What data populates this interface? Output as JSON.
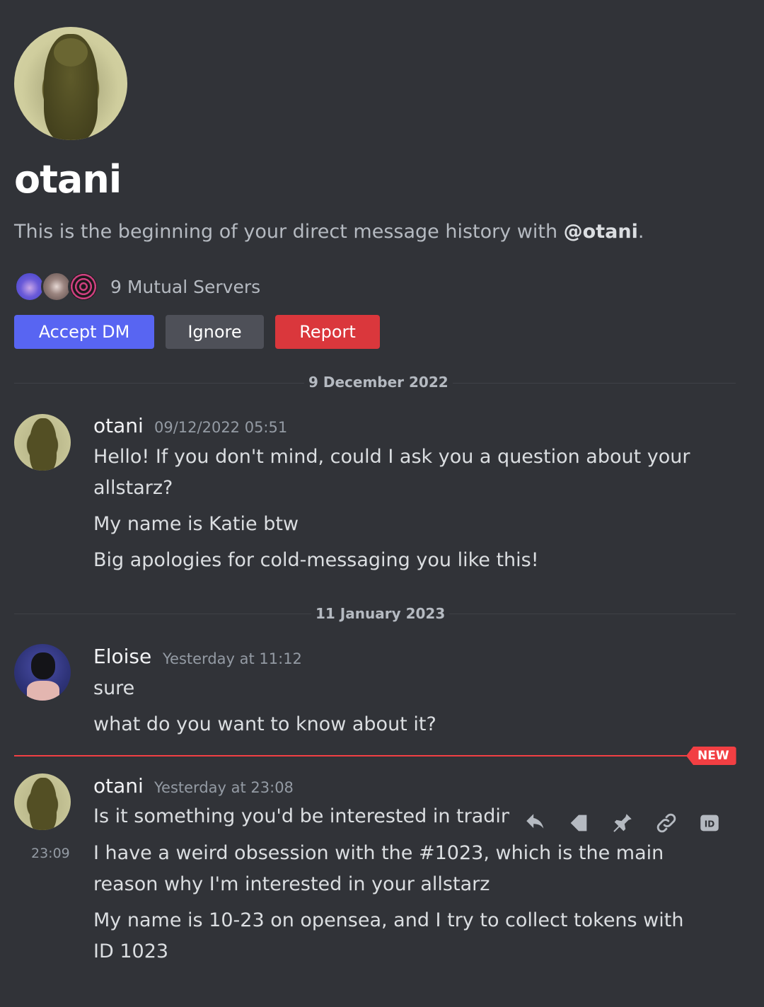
{
  "header": {
    "username": "otani",
    "intro_prefix": "This is the beginning of your direct message history with ",
    "intro_handle": "@otani",
    "intro_suffix": ".",
    "mutual_servers": "9 Mutual Servers"
  },
  "actions": {
    "accept": "Accept DM",
    "ignore": "Ignore",
    "report": "Report"
  },
  "dividers": {
    "first": "9 December 2022",
    "second": "11 January 2023",
    "new_badge": "NEW"
  },
  "messages": [
    {
      "author": "otani",
      "timestamp": "09/12/2022 05:51",
      "lines": [
        "Hello! If you don't mind, could I ask you a question about your",
        "allstarz?",
        "My name is Katie btw",
        "Big apologies for cold-messaging you like this!"
      ]
    },
    {
      "author": "Eloise",
      "timestamp": "Yesterday at 11:12",
      "lines": [
        "sure",
        "what do you want to know about it?"
      ]
    },
    {
      "author": "otani",
      "timestamp": "Yesterday at 23:08",
      "hover_time": "23:09",
      "lines": [
        "Is it something you'd be interested in tradinɡ",
        "I have a weird obsession with the #1023, which is the main",
        "reason why I'm interested in your allstarz",
        "My name is 10-23 on opensea, and I try to collect tokens with",
        "ID 1023"
      ]
    }
  ],
  "toolbar": {
    "icons": [
      "reply-icon",
      "forward-icon",
      "pin-icon",
      "link-icon",
      "id-icon"
    ],
    "id_label": "ID"
  },
  "colors": {
    "background": "#313338",
    "accept": "#5865f2",
    "ignore": "#4e5058",
    "report": "#da373c",
    "new": "#f23f43"
  }
}
